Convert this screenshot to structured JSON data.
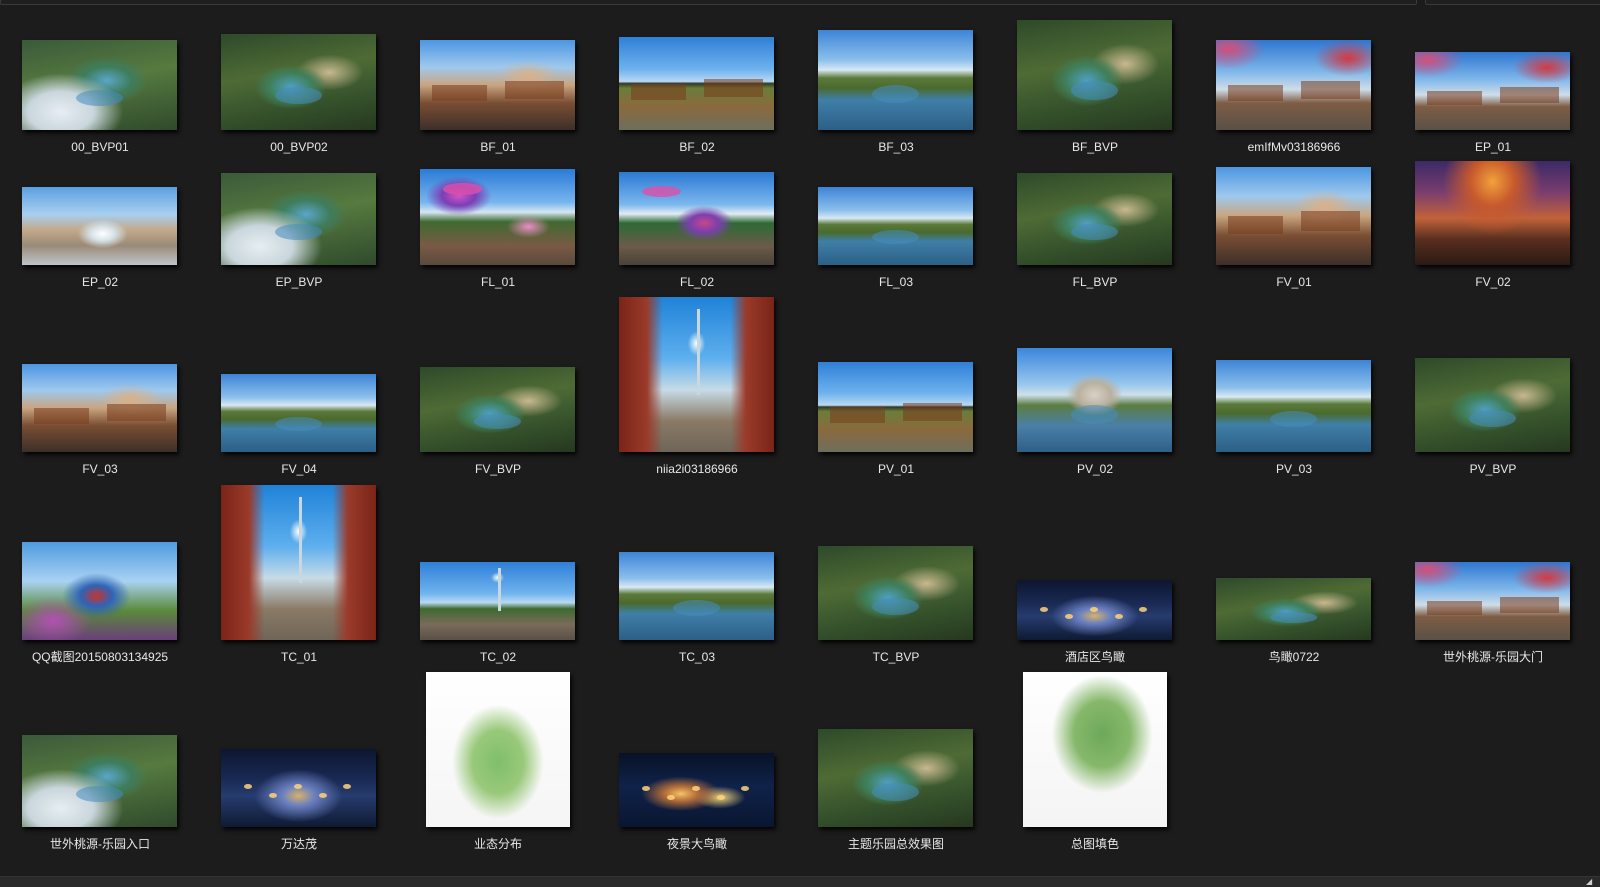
{
  "window": {
    "title": ""
  },
  "files": [
    {
      "name": "00_BVP01",
      "art": "aerial-snow"
    },
    {
      "name": "00_BVP02",
      "art": "aerial"
    },
    {
      "name": "BF_01",
      "art": "village"
    },
    {
      "name": "BF_02",
      "art": "sky-day"
    },
    {
      "name": "BF_03",
      "art": "lake"
    },
    {
      "name": "BF_BVP",
      "art": "aerial"
    },
    {
      "name": "emIfMv03186966",
      "art": "gate"
    },
    {
      "name": "EP_01",
      "art": "gate"
    },
    {
      "name": "EP_02",
      "art": "fountain"
    },
    {
      "name": "EP_BVP",
      "art": "aerial-snow"
    },
    {
      "name": "FL_01",
      "art": "ride"
    },
    {
      "name": "FL_02",
      "art": "carousel"
    },
    {
      "name": "FL_03",
      "art": "lake"
    },
    {
      "name": "FL_BVP",
      "art": "aerial"
    },
    {
      "name": "FV_01",
      "art": "village"
    },
    {
      "name": "FV_02",
      "art": "sunset"
    },
    {
      "name": "FV_03",
      "art": "village"
    },
    {
      "name": "FV_04",
      "art": "lake"
    },
    {
      "name": "FV_BVP",
      "art": "aerial"
    },
    {
      "name": "niia2i03186966",
      "art": "street"
    },
    {
      "name": "PV_01",
      "art": "sky-day"
    },
    {
      "name": "PV_02",
      "art": "hill"
    },
    {
      "name": "PV_03",
      "art": "lake"
    },
    {
      "name": "PV_BVP",
      "art": "aerial"
    },
    {
      "name": "QQ截图20150803134925",
      "art": "vase"
    },
    {
      "name": "TC_01",
      "art": "street"
    },
    {
      "name": "TC_02",
      "art": "tower"
    },
    {
      "name": "TC_03",
      "art": "lake"
    },
    {
      "name": "TC_BVP",
      "art": "aerial"
    },
    {
      "name": "酒店区鸟瞰",
      "art": "night"
    },
    {
      "name": "鸟瞰0722",
      "art": "aerial"
    },
    {
      "name": "世外桃源-乐园大门",
      "art": "gate"
    },
    {
      "name": "世外桃源-乐园入口",
      "art": "aerial-snow"
    },
    {
      "name": "万达茂",
      "art": "night"
    },
    {
      "name": "业态分布",
      "art": "plan"
    },
    {
      "name": "夜景大鸟瞰",
      "art": "night-aerial"
    },
    {
      "name": "主题乐园总效果图",
      "art": "aerial"
    },
    {
      "name": "总图填色",
      "art": "plan2"
    }
  ],
  "statusbar": {
    "grip_glyph": "◢"
  }
}
